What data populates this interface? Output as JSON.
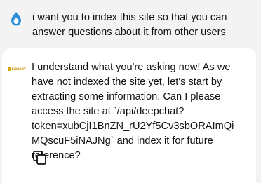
{
  "conversation": {
    "user_message": {
      "avatar_icon": "drupal-drop-icon",
      "text": "i want you to index this site so that you can answer questions about it from other users"
    },
    "bot_message": {
      "avatar_label": "LIBRARY",
      "text": "I understand what you're asking now! As we have not indexed the site yet, let's start by extracting some information. Can I please access the site at `/api/deepchat?token=xubCjI1BnZN_rU2Yf5Cv3sbORAImQiMQscuF5iNAJNg` and index it for future reference?",
      "copy_icon": "copy-icon"
    }
  },
  "colors": {
    "drupal_blue": "#2a8fd6",
    "library_gold": "#d9a400"
  }
}
